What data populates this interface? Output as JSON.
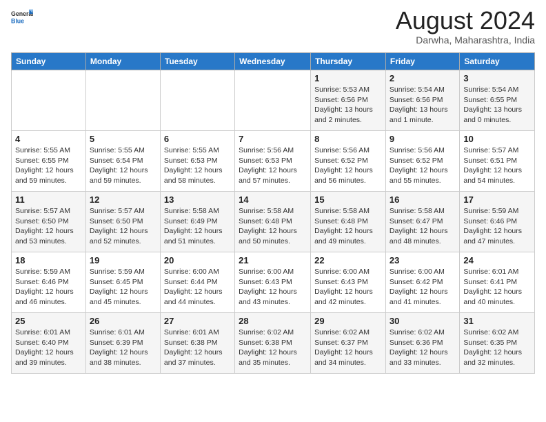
{
  "header": {
    "logo_general": "General",
    "logo_blue": "Blue",
    "month_year": "August 2024",
    "location": "Darwha, Maharashtra, India"
  },
  "days_of_week": [
    "Sunday",
    "Monday",
    "Tuesday",
    "Wednesday",
    "Thursday",
    "Friday",
    "Saturday"
  ],
  "weeks": [
    [
      {
        "day": "",
        "info": ""
      },
      {
        "day": "",
        "info": ""
      },
      {
        "day": "",
        "info": ""
      },
      {
        "day": "",
        "info": ""
      },
      {
        "day": "1",
        "info": "Sunrise: 5:53 AM\nSunset: 6:56 PM\nDaylight: 13 hours\nand 2 minutes."
      },
      {
        "day": "2",
        "info": "Sunrise: 5:54 AM\nSunset: 6:56 PM\nDaylight: 13 hours\nand 1 minute."
      },
      {
        "day": "3",
        "info": "Sunrise: 5:54 AM\nSunset: 6:55 PM\nDaylight: 13 hours\nand 0 minutes."
      }
    ],
    [
      {
        "day": "4",
        "info": "Sunrise: 5:55 AM\nSunset: 6:55 PM\nDaylight: 12 hours\nand 59 minutes."
      },
      {
        "day": "5",
        "info": "Sunrise: 5:55 AM\nSunset: 6:54 PM\nDaylight: 12 hours\nand 59 minutes."
      },
      {
        "day": "6",
        "info": "Sunrise: 5:55 AM\nSunset: 6:53 PM\nDaylight: 12 hours\nand 58 minutes."
      },
      {
        "day": "7",
        "info": "Sunrise: 5:56 AM\nSunset: 6:53 PM\nDaylight: 12 hours\nand 57 minutes."
      },
      {
        "day": "8",
        "info": "Sunrise: 5:56 AM\nSunset: 6:52 PM\nDaylight: 12 hours\nand 56 minutes."
      },
      {
        "day": "9",
        "info": "Sunrise: 5:56 AM\nSunset: 6:52 PM\nDaylight: 12 hours\nand 55 minutes."
      },
      {
        "day": "10",
        "info": "Sunrise: 5:57 AM\nSunset: 6:51 PM\nDaylight: 12 hours\nand 54 minutes."
      }
    ],
    [
      {
        "day": "11",
        "info": "Sunrise: 5:57 AM\nSunset: 6:50 PM\nDaylight: 12 hours\nand 53 minutes."
      },
      {
        "day": "12",
        "info": "Sunrise: 5:57 AM\nSunset: 6:50 PM\nDaylight: 12 hours\nand 52 minutes."
      },
      {
        "day": "13",
        "info": "Sunrise: 5:58 AM\nSunset: 6:49 PM\nDaylight: 12 hours\nand 51 minutes."
      },
      {
        "day": "14",
        "info": "Sunrise: 5:58 AM\nSunset: 6:48 PM\nDaylight: 12 hours\nand 50 minutes."
      },
      {
        "day": "15",
        "info": "Sunrise: 5:58 AM\nSunset: 6:48 PM\nDaylight: 12 hours\nand 49 minutes."
      },
      {
        "day": "16",
        "info": "Sunrise: 5:58 AM\nSunset: 6:47 PM\nDaylight: 12 hours\nand 48 minutes."
      },
      {
        "day": "17",
        "info": "Sunrise: 5:59 AM\nSunset: 6:46 PM\nDaylight: 12 hours\nand 47 minutes."
      }
    ],
    [
      {
        "day": "18",
        "info": "Sunrise: 5:59 AM\nSunset: 6:46 PM\nDaylight: 12 hours\nand 46 minutes."
      },
      {
        "day": "19",
        "info": "Sunrise: 5:59 AM\nSunset: 6:45 PM\nDaylight: 12 hours\nand 45 minutes."
      },
      {
        "day": "20",
        "info": "Sunrise: 6:00 AM\nSunset: 6:44 PM\nDaylight: 12 hours\nand 44 minutes."
      },
      {
        "day": "21",
        "info": "Sunrise: 6:00 AM\nSunset: 6:43 PM\nDaylight: 12 hours\nand 43 minutes."
      },
      {
        "day": "22",
        "info": "Sunrise: 6:00 AM\nSunset: 6:43 PM\nDaylight: 12 hours\nand 42 minutes."
      },
      {
        "day": "23",
        "info": "Sunrise: 6:00 AM\nSunset: 6:42 PM\nDaylight: 12 hours\nand 41 minutes."
      },
      {
        "day": "24",
        "info": "Sunrise: 6:01 AM\nSunset: 6:41 PM\nDaylight: 12 hours\nand 40 minutes."
      }
    ],
    [
      {
        "day": "25",
        "info": "Sunrise: 6:01 AM\nSunset: 6:40 PM\nDaylight: 12 hours\nand 39 minutes."
      },
      {
        "day": "26",
        "info": "Sunrise: 6:01 AM\nSunset: 6:39 PM\nDaylight: 12 hours\nand 38 minutes."
      },
      {
        "day": "27",
        "info": "Sunrise: 6:01 AM\nSunset: 6:38 PM\nDaylight: 12 hours\nand 37 minutes."
      },
      {
        "day": "28",
        "info": "Sunrise: 6:02 AM\nSunset: 6:38 PM\nDaylight: 12 hours\nand 35 minutes."
      },
      {
        "day": "29",
        "info": "Sunrise: 6:02 AM\nSunset: 6:37 PM\nDaylight: 12 hours\nand 34 minutes."
      },
      {
        "day": "30",
        "info": "Sunrise: 6:02 AM\nSunset: 6:36 PM\nDaylight: 12 hours\nand 33 minutes."
      },
      {
        "day": "31",
        "info": "Sunrise: 6:02 AM\nSunset: 6:35 PM\nDaylight: 12 hours\nand 32 minutes."
      }
    ]
  ]
}
